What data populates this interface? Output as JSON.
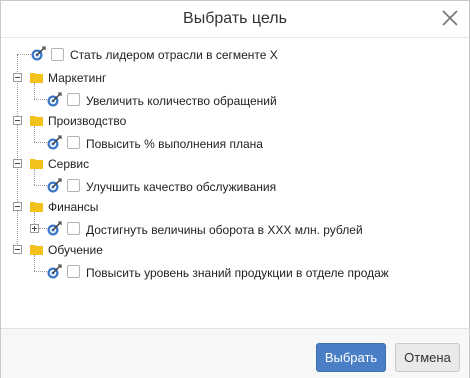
{
  "dialog": {
    "title": "Выбрать цель",
    "close_icon": "close-icon"
  },
  "tree": {
    "root_goal": {
      "label": "Стать лидером отрасли в сегменте X",
      "checked": false
    },
    "groups": [
      {
        "label": "Маркетинг",
        "expanded": true,
        "goals": [
          {
            "label": "Увеличить количество обращений",
            "checked": false
          }
        ]
      },
      {
        "label": "Производство",
        "expanded": true,
        "goals": [
          {
            "label": "Повысить % выполнения плана",
            "checked": false
          }
        ]
      },
      {
        "label": "Сервис",
        "expanded": true,
        "goals": [
          {
            "label": "Улучшить качество обслуживания",
            "checked": false
          }
        ]
      },
      {
        "label": "Финансы",
        "expanded": true,
        "goals": [
          {
            "label": "Достигнуть величины оборота в ХХХ млн. рублей",
            "checked": false,
            "has_children": true
          }
        ]
      },
      {
        "label": "Обучение",
        "expanded": true,
        "goals": [
          {
            "label": "Повысить уровень знаний продукции в отделе продаж",
            "checked": false
          }
        ]
      }
    ],
    "icons": {
      "folder": "folder-icon",
      "goal": "target-goal-icon"
    },
    "colors": {
      "folder": "#f2c21b",
      "goal": "#3c78c8"
    }
  },
  "footer": {
    "select_label": "Выбрать",
    "cancel_label": "Отмена"
  }
}
